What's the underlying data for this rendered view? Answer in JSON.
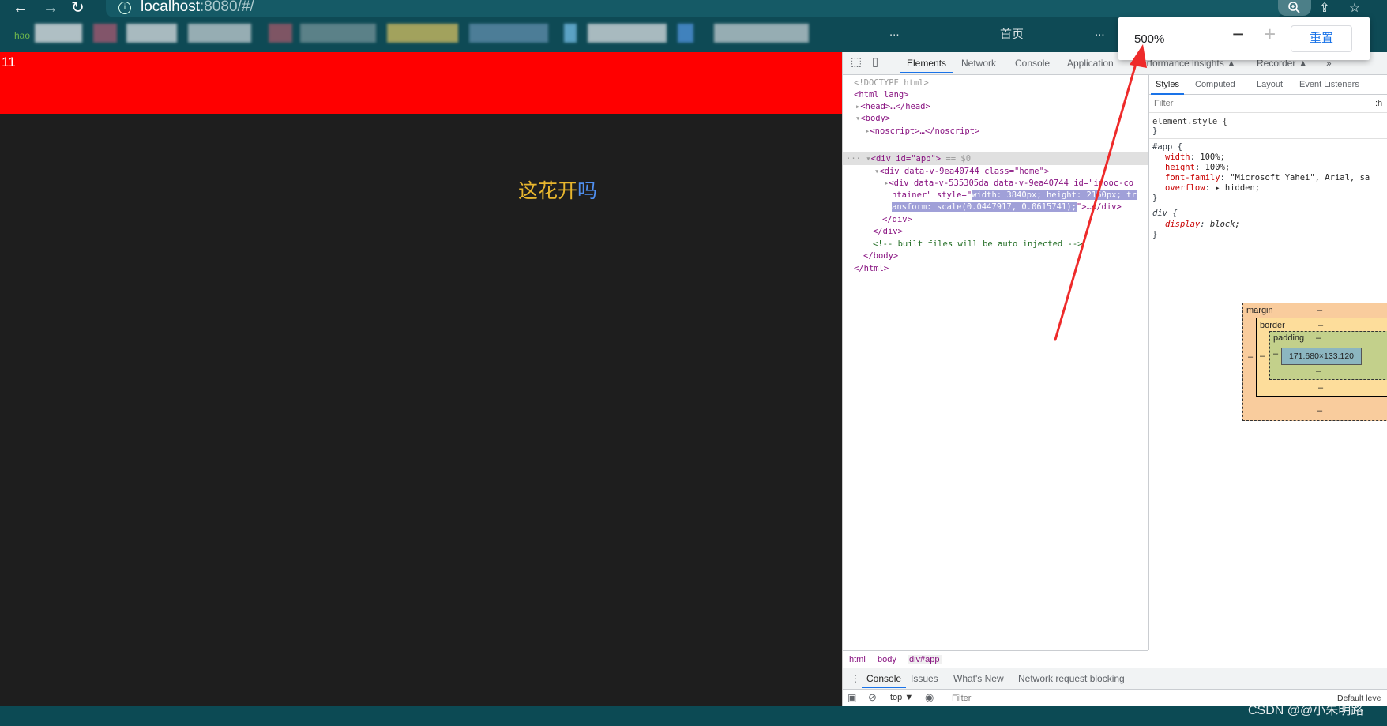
{
  "browser": {
    "url_host": "localhost",
    "url_rest": ":8080/#/",
    "zoom": {
      "percent": "500%",
      "minus": "−",
      "plus": "+",
      "reset_label": "重置"
    },
    "bookmarks": {
      "logo": "hao",
      "visible_snippets": [
        "...",
        "首页",
        "..."
      ]
    }
  },
  "page": {
    "counter": "11",
    "headline_part1": "这花开",
    "headline_part2": "吗",
    "colors": {
      "banner": "#ff0000",
      "background": "#1e1e1e",
      "headline": "#e8b62e",
      "headline_accent": "#4f8ff0"
    }
  },
  "devtools": {
    "tabs": [
      "Elements",
      "Network",
      "Console",
      "Application",
      "Performance insights ▲",
      "Recorder ▲",
      "»"
    ],
    "active_tab": "Elements",
    "dom": {
      "doctype": "<!DOCTYPE html>",
      "html_open": "<html lang>",
      "head": "<head>…</head>",
      "body_open": "<body>",
      "noscript": "<noscript>…</noscript>",
      "app_div": "<div id=\"app\">",
      "app_div_suffix": " == $0",
      "home_div": "<div data-v-9ea40744 class=\"home\">",
      "container_div_1": "<div data-v-535305da data-v-9ea40744 id=\"imooc-co",
      "container_div_2_a": "ntainer\" style=\"",
      "container_div_2_hl": "width: 3840px; height: 2160px; tr",
      "container_div_3_hl": "ansform: scale(0.0447917, 0.0615741);",
      "container_div_3_rest": "\">…</div>",
      "close_div_1": "</div>",
      "close_div_2": "</div>",
      "comment": "<!-- built files will be auto injected -->",
      "body_close": "</body>",
      "html_close": "</html>"
    },
    "breadcrumbs": [
      "html",
      "body",
      "div#app"
    ],
    "styles": {
      "tabs": [
        "Styles",
        "Computed",
        "Layout",
        "Event Listeners"
      ],
      "active_tab": "Styles",
      "filter_placeholder": "Filter",
      "filter_suffix": ":h",
      "element_style_open": "element.style {",
      "brace_close": "}",
      "app_selector": "#app {",
      "app_props": [
        {
          "name": "width",
          "value": "100%;"
        },
        {
          "name": "height",
          "value": "100%;"
        },
        {
          "name": "font-family",
          "value": "\"Microsoft Yahei\", Arial, sa"
        },
        {
          "name": "overflow",
          "value": "▸ hidden;"
        }
      ],
      "div_selector": "div {",
      "div_prop": {
        "name": "display",
        "value": "block;"
      },
      "box_model": {
        "margin": "margin",
        "border": "border",
        "padding": "padding",
        "dash": "–",
        "content": "171.680×133.120"
      }
    },
    "drawer": {
      "tabs": [
        "Console",
        "Issues",
        "What's New",
        "Network request blocking"
      ],
      "active_tab": "Console",
      "context": "top ▼",
      "filter_placeholder": "Filter",
      "levels": "Default leve"
    }
  },
  "watermark": "CSDN @@小朱明路"
}
